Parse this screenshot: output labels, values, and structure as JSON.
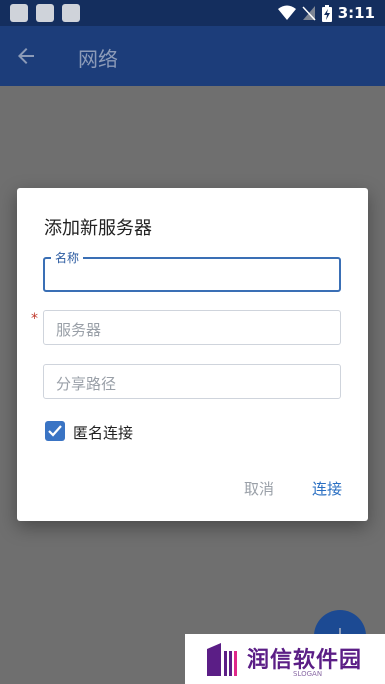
{
  "status_bar": {
    "time": "3:11"
  },
  "app_bar": {
    "title": "网络"
  },
  "dialog": {
    "title": "添加新服务器",
    "name_field": {
      "label": "名称",
      "value": ""
    },
    "server_field": {
      "placeholder": "服务器",
      "required_mark": "*"
    },
    "share_field": {
      "placeholder": "分享路径"
    },
    "anonymous_checkbox": {
      "label": "匿名连接",
      "checked": true
    },
    "cancel_label": "取消",
    "connect_label": "连接"
  },
  "watermark": {
    "brand": "润信软件园",
    "slogan": "SLOGAN"
  },
  "colors": {
    "primary": "#1c3d7a",
    "accent": "#3a74c4",
    "status_bar": "#142e5e"
  }
}
